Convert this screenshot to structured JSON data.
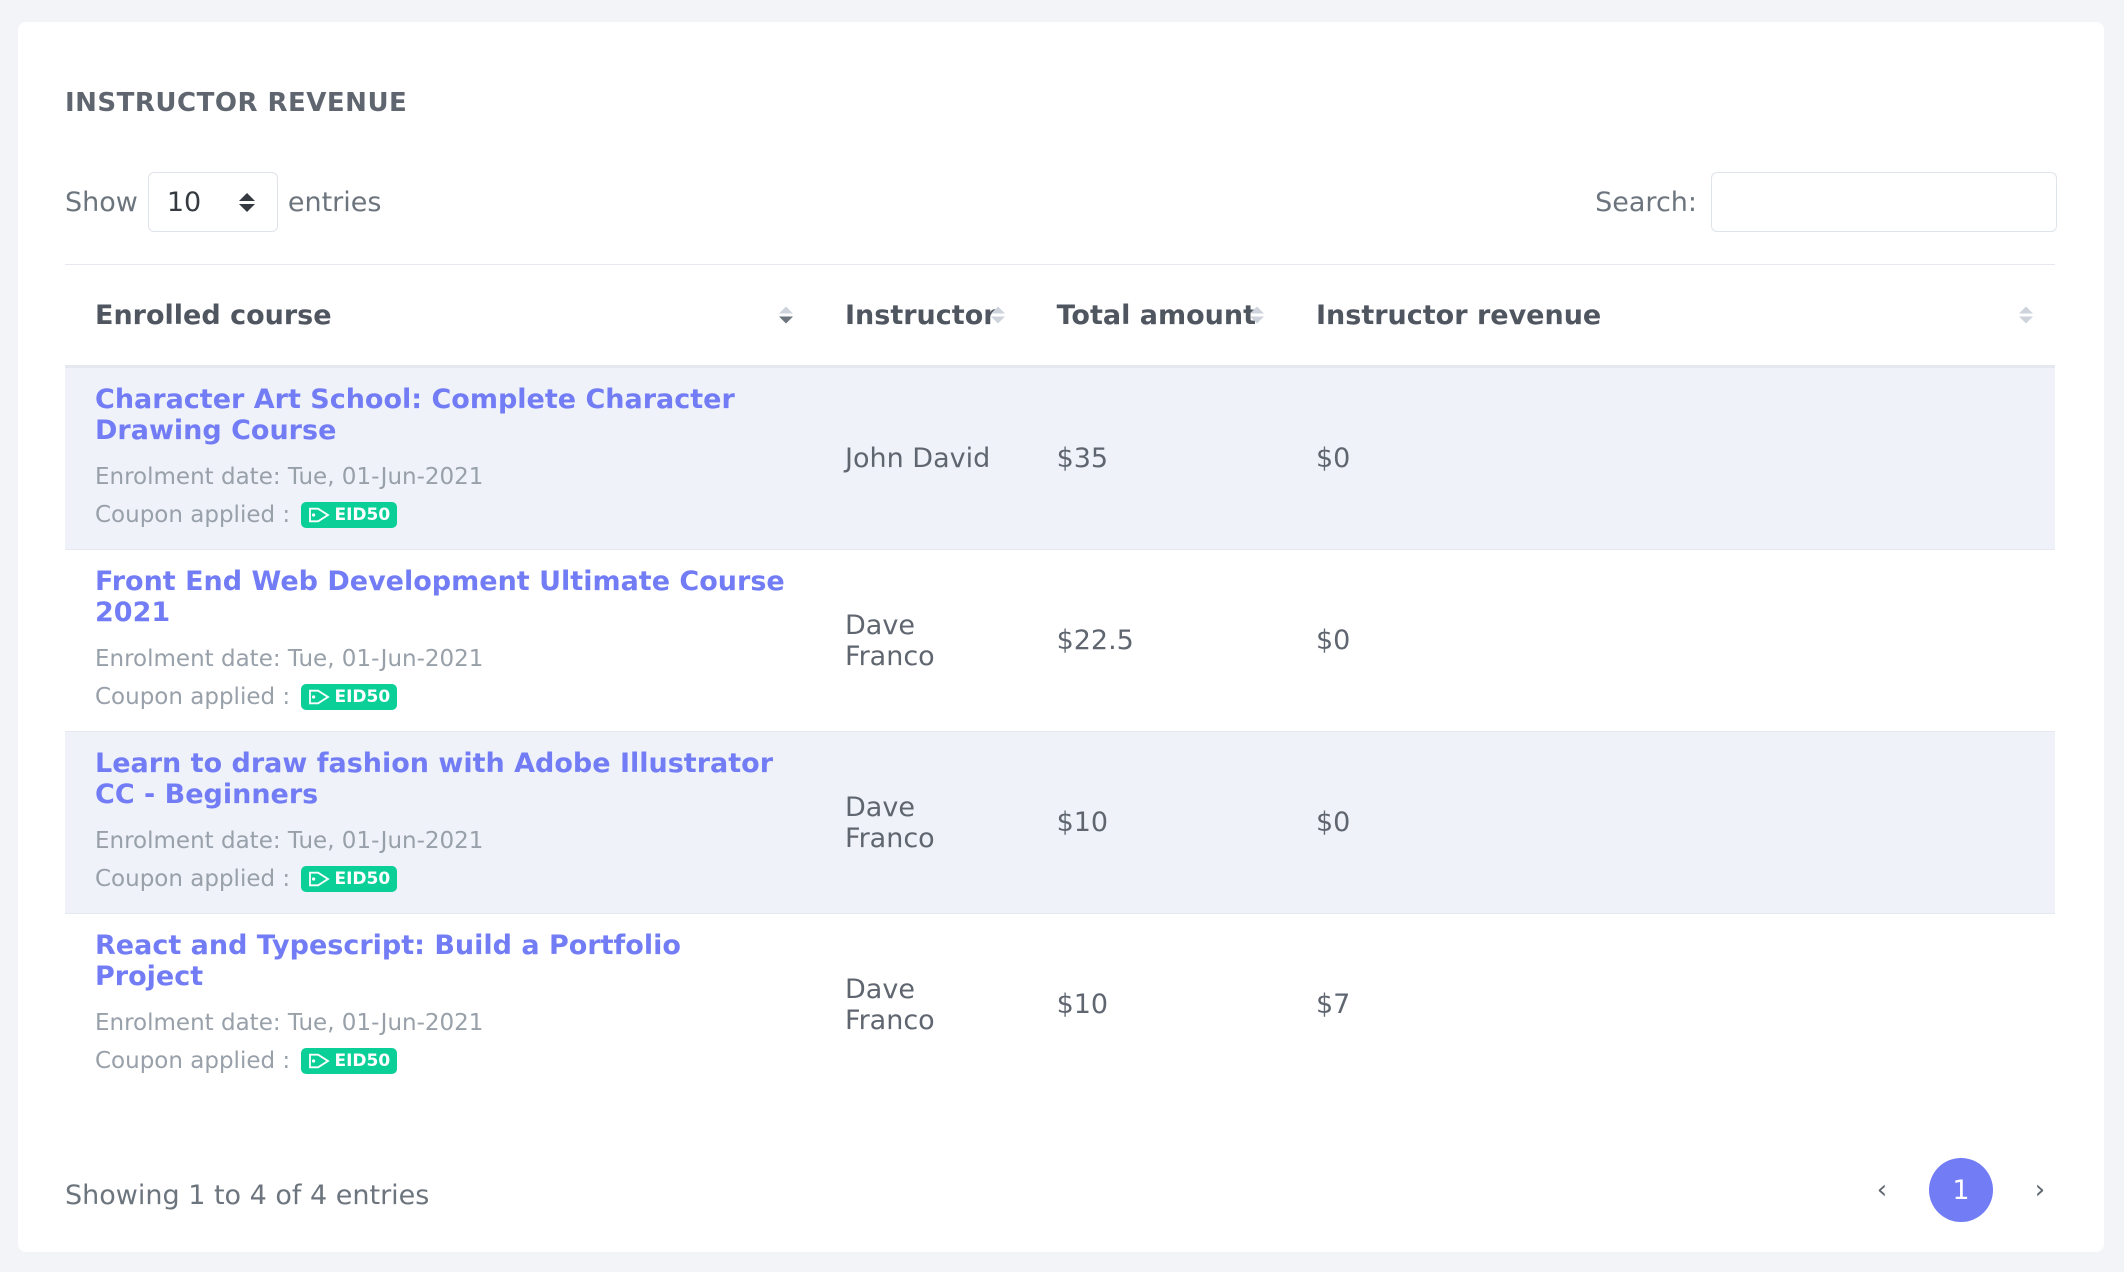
{
  "card": {
    "title": "INSTRUCTOR REVENUE"
  },
  "length": {
    "label_before": "Show",
    "value": "10",
    "label_after": "entries"
  },
  "search": {
    "label": "Search:",
    "value": ""
  },
  "table": {
    "headers": [
      "Enrolled course",
      "Instructor",
      "Total amount",
      "Instructor revenue"
    ],
    "rows": [
      {
        "course": "Character Art School: Complete Character Drawing Course",
        "enrolment": "Enrolment date: Tue, 01-Jun-2021",
        "coupon_label": "Coupon applied :",
        "coupon_code": "EID50",
        "instructor": "John David",
        "total": "$35",
        "revenue": "$0"
      },
      {
        "course": "Front End Web Development Ultimate Course 2021",
        "enrolment": "Enrolment date: Tue, 01-Jun-2021",
        "coupon_label": "Coupon applied :",
        "coupon_code": "EID50",
        "instructor": "Dave Franco",
        "total": "$22.5",
        "revenue": "$0"
      },
      {
        "course": "Learn to draw fashion with Adobe Illustrator CC - Beginners",
        "enrolment": "Enrolment date: Tue, 01-Jun-2021",
        "coupon_label": "Coupon applied :",
        "coupon_code": "EID50",
        "instructor": "Dave Franco",
        "total": "$10",
        "revenue": "$0"
      },
      {
        "course": "React and Typescript: Build a Portfolio Project",
        "enrolment": "Enrolment date: Tue, 01-Jun-2021",
        "coupon_label": "Coupon applied :",
        "coupon_code": "EID50",
        "instructor": "Dave Franco",
        "total": "$10",
        "revenue": "$7"
      }
    ]
  },
  "footer": {
    "info": "Showing 1 to 4 of 4 entries",
    "prev_icon": "chevron-left-icon",
    "current_page": "1",
    "next_icon": "chevron-right-icon"
  },
  "colors": {
    "accent": "#727cf5",
    "badge": "#0acf97",
    "row_alt": "#eff2f9"
  }
}
